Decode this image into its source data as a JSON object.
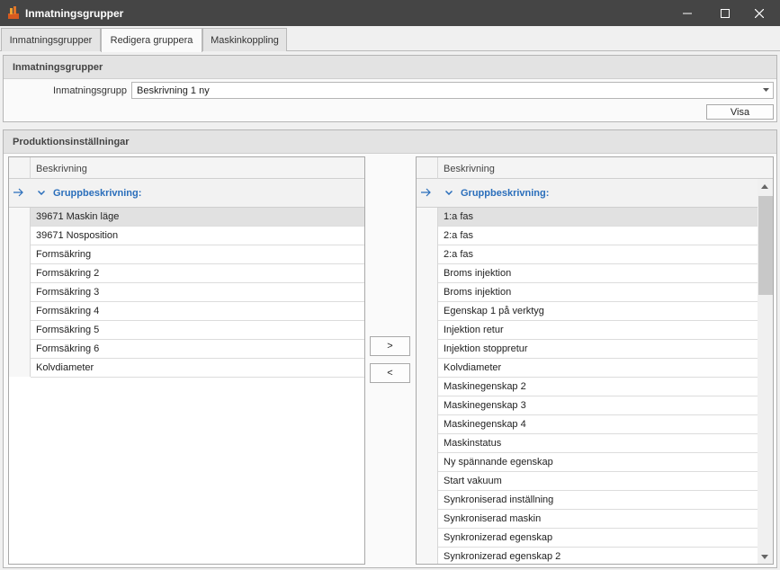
{
  "window": {
    "title": "Inmatningsgrupper",
    "icon": "app-logo-icon",
    "controls": [
      "minimize-icon",
      "maximize-icon",
      "close-icon"
    ]
  },
  "tabs": [
    {
      "label": "Inmatningsgrupper",
      "active": false
    },
    {
      "label": "Redigera gruppera",
      "active": true
    },
    {
      "label": "Maskinkoppling",
      "active": false
    }
  ],
  "input_group": {
    "header": "Inmatningsgrupper",
    "field_label": "Inmatningsgrupp",
    "field_value": "Beskrivning 1 ny",
    "show_button": "Visa"
  },
  "production": {
    "header": "Produktionsinställningar",
    "move_right_button": ">",
    "move_left_button": "<",
    "left_grid": {
      "column": "Beskrivning",
      "group_label": "Gruppbeskrivning:",
      "selected_index": 0,
      "rows": [
        "39671 Maskin läge",
        "39671 Nosposition",
        "Formsäkring",
        "Formsäkring 2",
        "Formsäkring 3",
        "Formsäkring 4",
        "Formsäkring 5",
        "Formsäkring 6",
        "Kolvdiameter"
      ]
    },
    "right_grid": {
      "column": "Beskrivning",
      "group_label": "Gruppbeskrivning:",
      "selected_index": 0,
      "rows": [
        "1:a fas",
        "2:a fas",
        "2:a fas",
        "Broms injektion",
        "Broms injektion",
        "Egenskap 1 på verktyg",
        "Injektion retur",
        "Injektion stoppretur",
        "Kolvdiameter",
        "Maskinegenskap 2",
        "Maskinegenskap 3",
        "Maskinegenskap 4",
        "Maskinstatus",
        "Ny spännande egenskap",
        "Start vakuum",
        "Synkroniserad inställning",
        "Synkroniserad maskin",
        "Synkronizerad egenskap",
        "Synkronizerad egenskap 2"
      ]
    }
  },
  "colors": {
    "titlebar": "#454545",
    "group_text": "#2a6ebb",
    "selected_row": "#e1e1e1"
  }
}
